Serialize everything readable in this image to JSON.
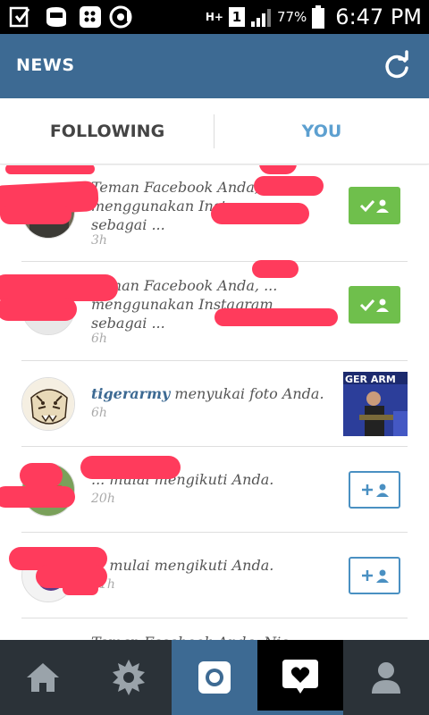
{
  "status_bar": {
    "battery": "77%",
    "time": "6:47 PM",
    "sim": "1",
    "network": "H+",
    "icons": [
      "download-icon",
      "bbm-icon",
      "chat-icon",
      "signal-icon",
      "battery-icon"
    ]
  },
  "header": {
    "title": "NEWS",
    "refresh_icon": "refresh-icon"
  },
  "tabs": [
    {
      "label": "FOLLOWING",
      "active": false
    },
    {
      "label": "YOU",
      "active": true
    }
  ],
  "feed": [
    {
      "text": "Teman Facebook Anda, ... menggunakan Instagram sebagai ...",
      "time": "3h",
      "action": "following"
    },
    {
      "text": "Teman Facebook Anda, ... menggunakan Instagram sebagai ...",
      "time": "6h",
      "action": "following"
    },
    {
      "username": "tigerarmy",
      "text": "menyukai foto Anda.",
      "time": "6h",
      "thumbnail_caption": "GER ARM"
    },
    {
      "text": "... mulai mengikuti Anda.",
      "time": "20h",
      "action": "follow"
    },
    {
      "text": "... mulai mengikuti Anda.",
      "time": "21h",
      "action": "follow"
    },
    {
      "text": "Teman Facebook Anda, Nic"
    }
  ],
  "bottom_nav": [
    {
      "icon": "home-icon",
      "active": false
    },
    {
      "icon": "explore-icon",
      "active": false
    },
    {
      "icon": "camera-icon",
      "active": false
    },
    {
      "icon": "activity-icon",
      "active": true
    },
    {
      "icon": "profile-icon",
      "active": false
    }
  ],
  "colors": {
    "header": "#3d6a93",
    "accent": "#5da0d0",
    "following_green": "#6fbf4c",
    "follow_blue": "#4a90c2",
    "redaction": "#ff3b5c"
  }
}
